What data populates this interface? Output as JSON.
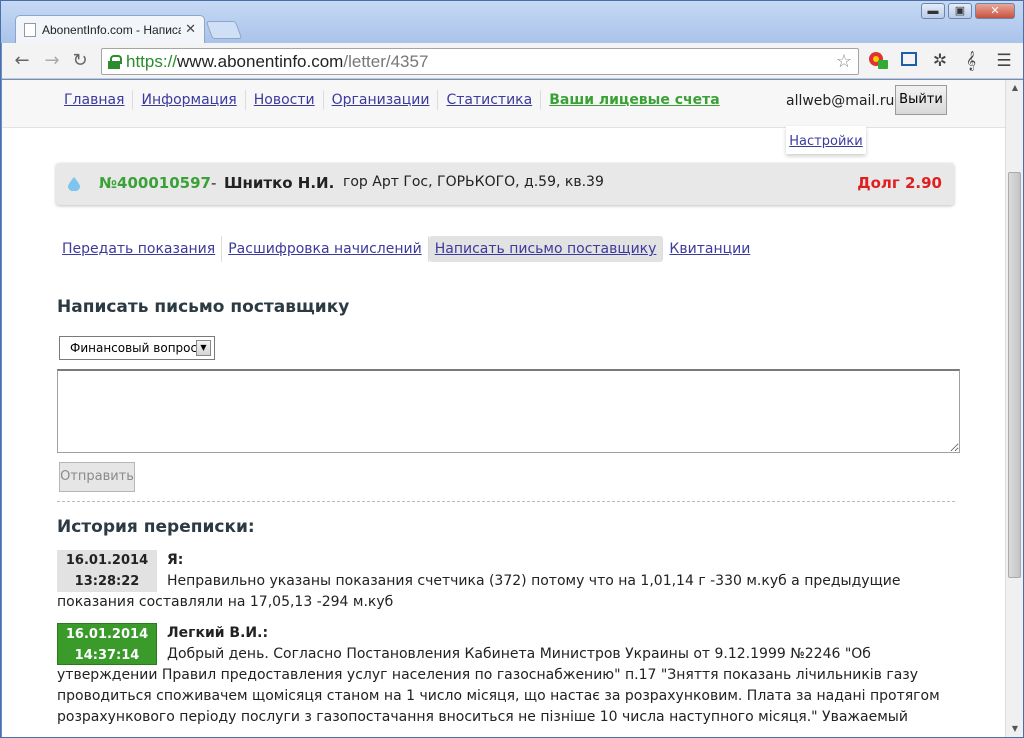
{
  "browser": {
    "tab_title": "AbonentInfo.com - Написат",
    "url_scheme": "https://",
    "url_host": "www.abonentinfo.com",
    "url_path": "/letter/4357",
    "window_buttons": {
      "minimize": "▬",
      "maximize": "▣",
      "close": "✕"
    }
  },
  "nav": {
    "items": [
      "Главная",
      "Информация",
      "Новости",
      "Организации",
      "Статистика"
    ],
    "active": "Ваши лицевые счета"
  },
  "user": {
    "email": "allweb@mail.ru",
    "logout_label": "Выйти",
    "settings_label": "Настройки"
  },
  "account": {
    "number": "№400010597",
    "dash": "-",
    "name": "Шнитко Н.И.",
    "address": "гор Арт Гос, ГОРЬКОГО, д.59, кв.39",
    "debt": "Долг 2.90",
    "debt_color": "#e02020"
  },
  "subtabs": [
    "Передать показания",
    "Расшифровка начислений",
    "Написать письмо поставщику",
    "Квитанции"
  ],
  "compose": {
    "title": "Написать письмо поставщику",
    "topic_selected": "Финансовый вопрос",
    "message_value": "",
    "send_label": "Отправить"
  },
  "history": {
    "title": "История переписки:",
    "messages": [
      {
        "date": "16.01.2014",
        "time": "13:28:22",
        "author": "Я:",
        "text": "Неправильно указаны показания счетчика (372) потому что на 1,01,14 г -330 м.куб а предыдущие показания составляли на 17,05,13 -294 м.куб"
      },
      {
        "date": "16.01.2014",
        "time": "14:37:14",
        "author": "Легкий В.И.:",
        "text": "Добрый день. Согласно Постановления Кабинета Министров Украины от 9.12.1999 №2246 \"Об утверждении Правил предоставления услуг населения по газоснабжению\" п.17 \"Зняття показань лічильників газу проводиться споживачем щомісяця станом на 1 число місяця, що настає за розрахунковим. Плата за надані протягом розрахункового періоду послуги з газопостачання вноситься не пізніше 10 числа наступного місяця.\" Уважаемый"
      }
    ]
  },
  "colors": {
    "link": "#3b3b9e",
    "active_green": "#3aa137",
    "reply_badge": "#3a9a2a"
  }
}
